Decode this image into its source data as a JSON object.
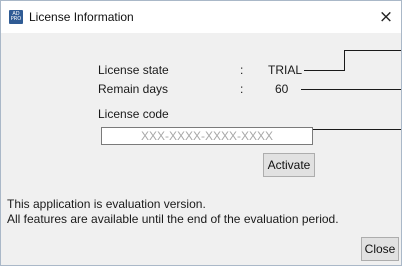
{
  "window": {
    "title": "License Information",
    "app_icon_text": "AD\nPRO",
    "close_glyph": "×"
  },
  "license": {
    "state_label": "License state",
    "state_sep": ":",
    "state_value": "TRIAL",
    "days_label": "Remain days",
    "days_sep": ":",
    "days_value": "60",
    "code_label": "License code",
    "code_placeholder": "XXX-XXXX-XXXX-XXXX",
    "code_value": ""
  },
  "buttons": {
    "activate_label": "Activate",
    "close_label": "Close"
  },
  "notice": {
    "line1": "This application is evaluation version.",
    "line2": "All features are available until the end of the evaluation period."
  }
}
